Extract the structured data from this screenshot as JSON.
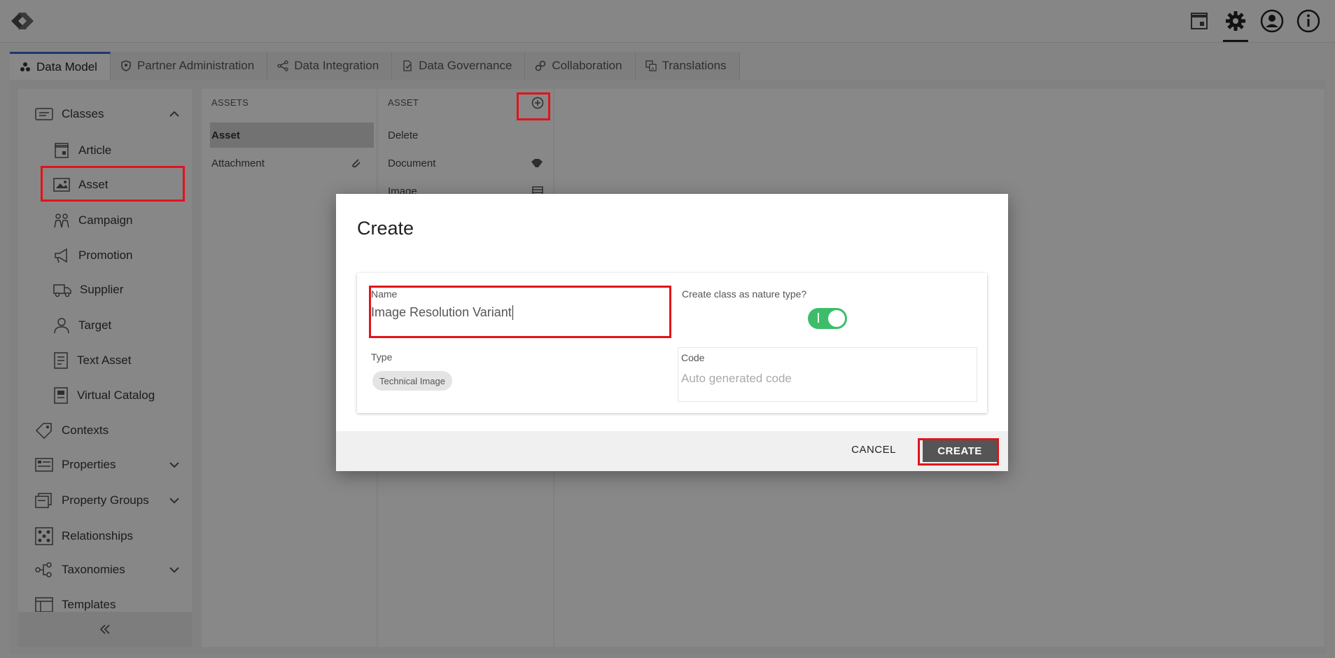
{
  "tabs": [
    {
      "label": "Data Model",
      "icon": "data-model-icon",
      "active": true
    },
    {
      "label": "Partner Administration",
      "icon": "shield-icon"
    },
    {
      "label": "Data Integration",
      "icon": "share-nodes-icon"
    },
    {
      "label": "Data Governance",
      "icon": "governance-icon"
    },
    {
      "label": "Collaboration",
      "icon": "gears-icon"
    },
    {
      "label": "Translations",
      "icon": "translate-icon"
    }
  ],
  "sidebar": {
    "classes_label": "Classes",
    "class_items": [
      "Article",
      "Asset",
      "Campaign",
      "Promotion",
      "Supplier",
      "Target",
      "Text Asset",
      "Virtual Catalog"
    ],
    "contexts": "Contexts",
    "properties": "Properties",
    "property_groups": "Property Groups",
    "relationships": "Relationships",
    "taxonomies": "Taxonomies",
    "templates": "Templates"
  },
  "assets_column": {
    "header": "ASSETS",
    "rows": [
      "Asset",
      "Attachment"
    ]
  },
  "asset_column": {
    "header": "ASSET",
    "rows": [
      "Delete",
      "Document",
      "Image"
    ]
  },
  "dialog": {
    "title": "Create",
    "name_label": "Name",
    "name_value": "Image Resolution Variant",
    "nature_label": "Create class as nature type?",
    "nature_enabled": true,
    "type_label": "Type",
    "type_value": "Technical Image",
    "code_label": "Code",
    "code_placeholder": "Auto generated code",
    "cancel_label": "CANCEL",
    "create_label": "CREATE"
  },
  "colors": {
    "highlight": "#e2131b",
    "toggle_on": "#3dbd6a",
    "create_button": "#555555",
    "active_tab_accent": "#3a64c8"
  }
}
